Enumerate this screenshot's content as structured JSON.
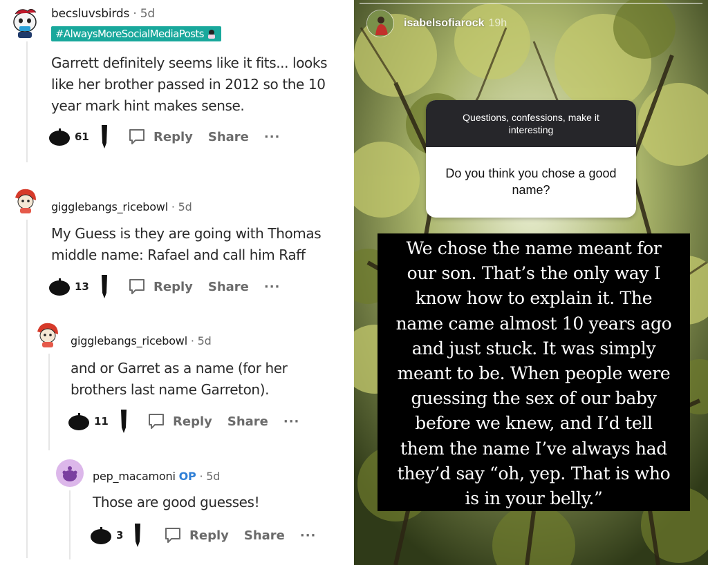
{
  "reddit": {
    "comments": [
      {
        "username": "becsluvsbirds",
        "age": "· 5d",
        "flair": "#AlwaysMoreSocialMediaPosts",
        "body_lines": [
          "Garrett definitely seems like it fits... looks",
          "like her brother passed in 2012 so the 10",
          "year mark hint makes sense."
        ],
        "votes": "61",
        "reply": "Reply",
        "share": "Share",
        "more": "···"
      },
      {
        "username": "gigglebangs_ricebowl",
        "age": "· 5d",
        "body_lines": [
          "My Guess is they are going with Thomas",
          "middle name: Rafael and call him Raff"
        ],
        "votes": "13",
        "reply": "Reply",
        "share": "Share",
        "more": "···"
      },
      {
        "username": "gigglebangs_ricebowl",
        "age": "· 5d",
        "body_lines": [
          "and or Garret as a name (for her",
          "brothers last name Garreton)."
        ],
        "votes": "11",
        "reply": "Reply",
        "share": "Share",
        "more": "···"
      },
      {
        "username": "pep_macamoni",
        "op_badge": "OP",
        "age": "· 5d",
        "body_lines": [
          "Those are good guesses!"
        ],
        "votes": "3",
        "reply": "Reply",
        "share": "Share",
        "more": "···"
      }
    ]
  },
  "story": {
    "username": "isabelsofiarock",
    "time": "19h",
    "question_prompt": "Questions, confessions, make it interesting",
    "question": "Do you think you chose a good name?",
    "answer_lines": [
      "We chose the name meant for",
      "our son. That’s the only way I",
      "know how to explain it. The",
      "name came almost 10 years ago",
      "and just stuck. It was simply",
      "meant to be. When people were",
      "guessing the sex of our baby",
      "before we knew, and I’d tell",
      "them the name I’ve always had",
      "they’d say “oh, yep. That is who",
      "is in your belly.”"
    ]
  },
  "colors": {
    "flair_bg": "#19a89c",
    "op_blue": "#2f7fd6",
    "meta_gray": "#6b6b6b",
    "question_header_bg": "#26262a",
    "answer_bg": "#000000"
  },
  "icons": [
    "upvote-icon",
    "downvote-icon",
    "reply-icon",
    "more-icon",
    "avatar-snoo-icon"
  ]
}
